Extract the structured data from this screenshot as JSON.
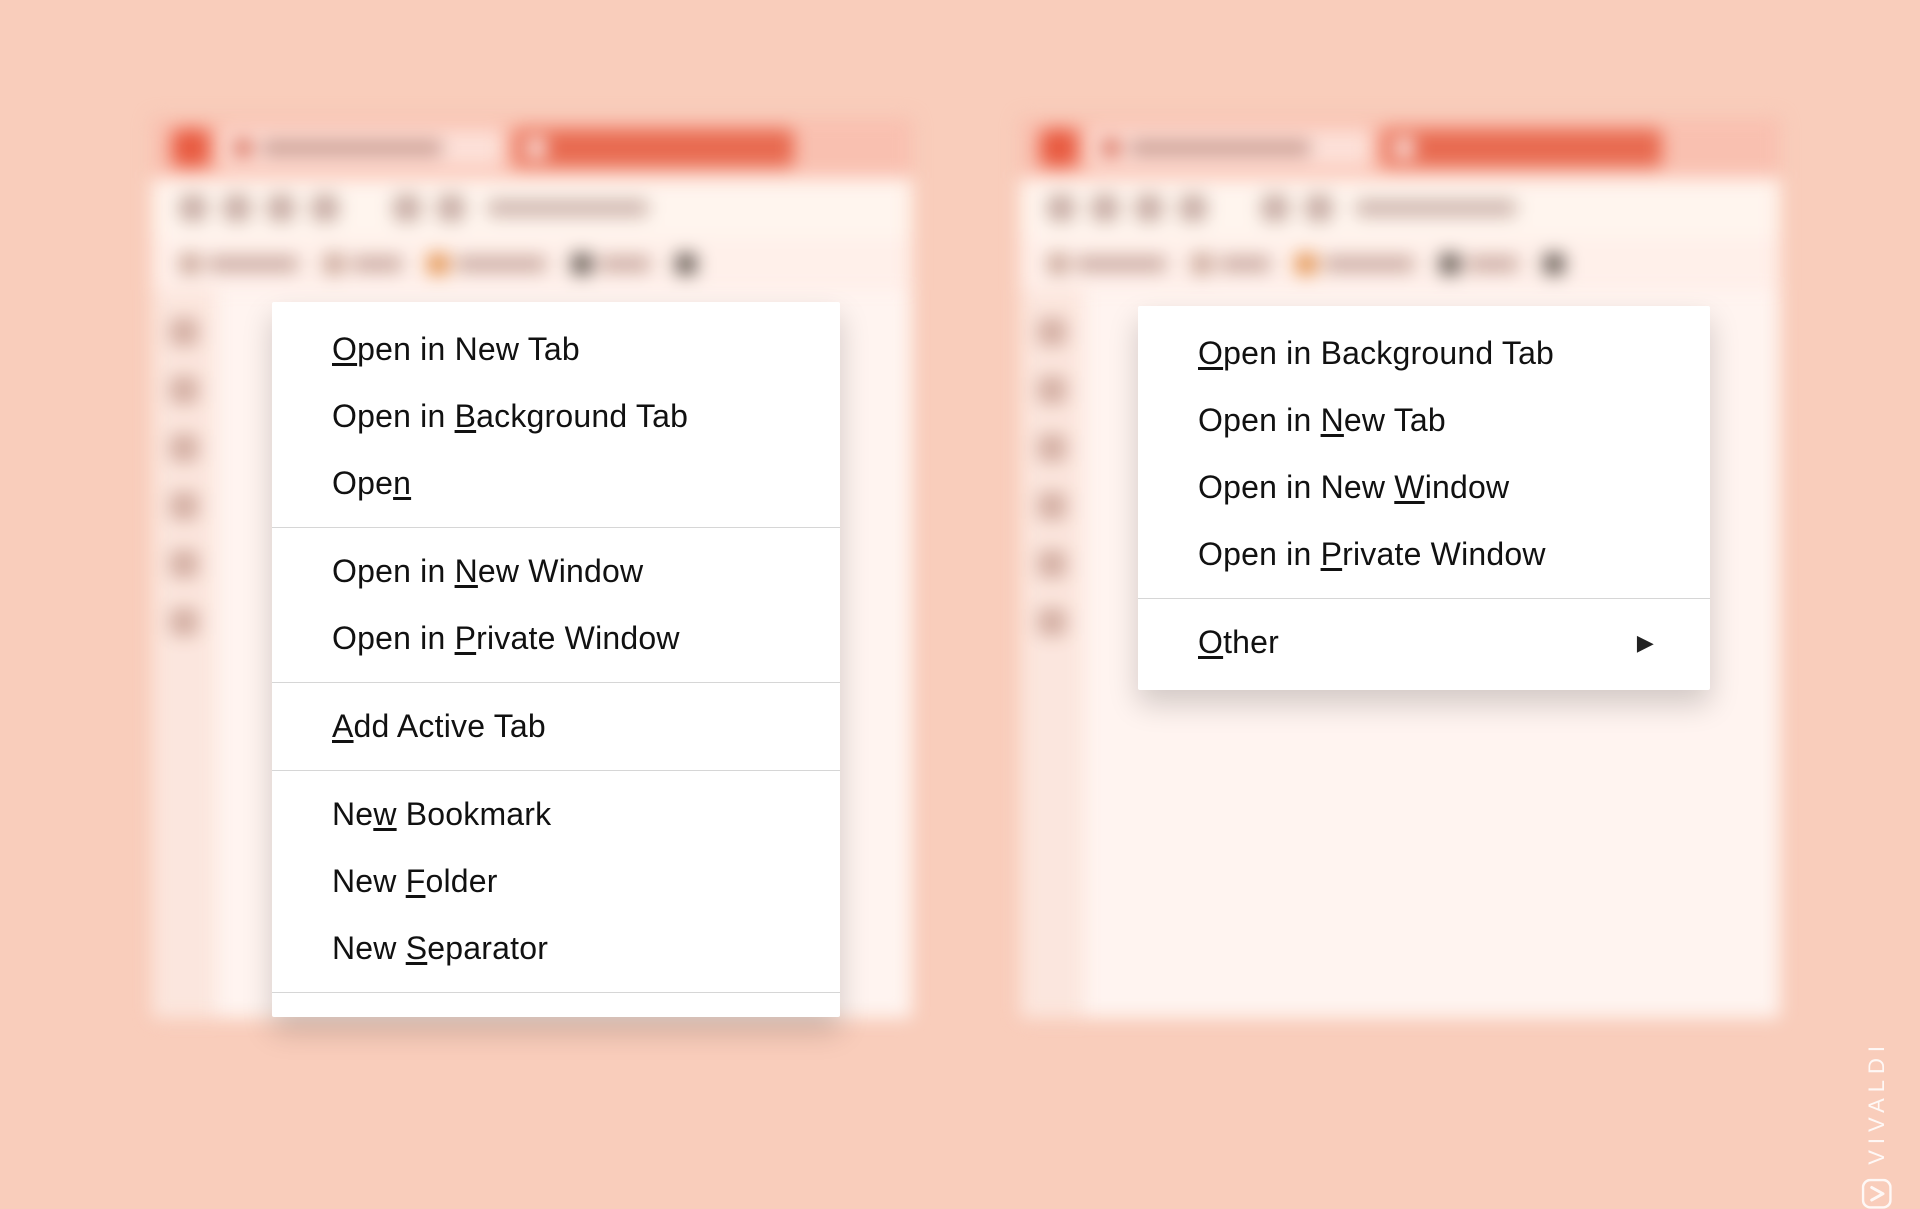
{
  "background": {
    "color": "#f9cdbb"
  },
  "browsers": {
    "tab_title_blur": "Vivaldi browser — Fast, pri…",
    "url_blur": "vivaldi.com",
    "bookmark_labels_blur": [
      "Entertainment",
      "News",
      "Stack Overflow",
      "GitHub"
    ]
  },
  "left_menu": {
    "items": [
      {
        "label": "Open in New Tab",
        "mnemonic_index": 0
      },
      {
        "label": "Open in Background Tab",
        "mnemonic_index": 8
      },
      {
        "label": "Open",
        "mnemonic_index": 3
      }
    ],
    "group2": [
      {
        "label": "Open in New Window",
        "mnemonic_index": 8
      },
      {
        "label": "Open in Private Window",
        "mnemonic_index": 8
      }
    ],
    "group3": [
      {
        "label": "Add Active Tab",
        "mnemonic_index": 0
      }
    ],
    "group4": [
      {
        "label": "New Bookmark",
        "mnemonic_index": 2
      },
      {
        "label": "New Folder",
        "mnemonic_index": 4
      },
      {
        "label": "New Separator",
        "mnemonic_index": 4
      }
    ]
  },
  "right_menu": {
    "items": [
      {
        "label": "Open in Background Tab",
        "mnemonic_index": 0
      },
      {
        "label": "Open in New Tab",
        "mnemonic_index": 8
      },
      {
        "label": "Open in New Window",
        "mnemonic_index": 12
      },
      {
        "label": "Open in Private Window",
        "mnemonic_index": 8
      }
    ],
    "other_label": "Other",
    "other_mnemonic_index": 0
  },
  "watermark": "VIVALDI"
}
